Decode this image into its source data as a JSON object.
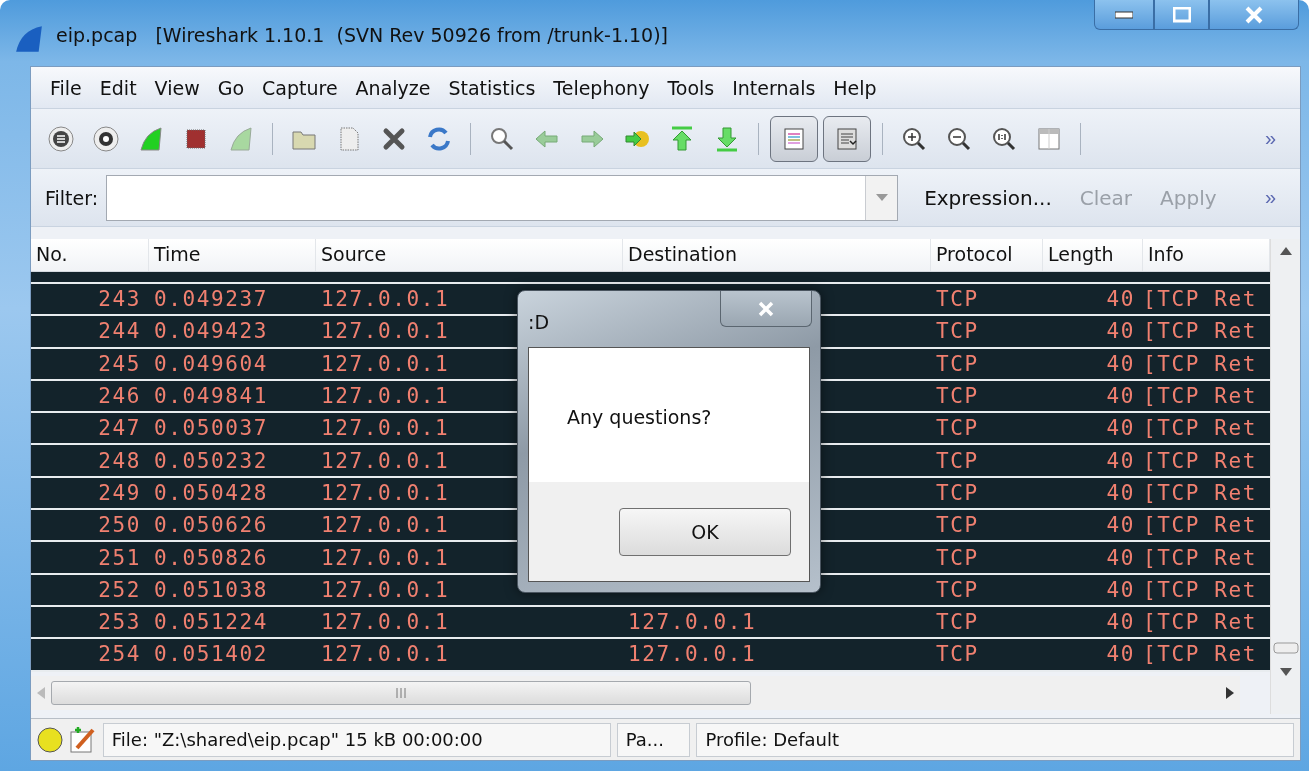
{
  "window": {
    "title": "eip.pcap   [Wireshark 1.10.1  (SVN Rev 50926 from /trunk-1.10)]"
  },
  "menu": [
    "File",
    "Edit",
    "View",
    "Go",
    "Capture",
    "Analyze",
    "Statistics",
    "Telephony",
    "Tools",
    "Internals",
    "Help"
  ],
  "toolbar_toggles": [
    {
      "pressed": true
    },
    {
      "pressed": true
    }
  ],
  "filter": {
    "label": "Filter:",
    "buttons": [
      {
        "label": "Expression...",
        "disabled": false
      },
      {
        "label": "Clear",
        "disabled": true
      },
      {
        "label": "Apply",
        "disabled": true
      }
    ],
    "more": "»"
  },
  "toolbar_more": "»",
  "table": {
    "columns": [
      "No.",
      "Time",
      "Source",
      "Destination",
      "Protocol",
      "Length",
      "Info"
    ],
    "rows": [
      {
        "no": "243",
        "time": "0.049237",
        "source": "127.0.0.1",
        "protocol": "TCP",
        "length": "40",
        "info": "[TCP Ret"
      },
      {
        "no": "244",
        "time": "0.049423",
        "source": "127.0.0.1",
        "protocol": "TCP",
        "length": "40",
        "info": "[TCP Ret"
      },
      {
        "no": "245",
        "time": "0.049604",
        "source": "127.0.0.1",
        "protocol": "TCP",
        "length": "40",
        "info": "[TCP Ret"
      },
      {
        "no": "246",
        "time": "0.049841",
        "source": "127.0.0.1",
        "protocol": "TCP",
        "length": "40",
        "info": "[TCP Ret"
      },
      {
        "no": "247",
        "time": "0.050037",
        "source": "127.0.0.1",
        "protocol": "TCP",
        "length": "40",
        "info": "[TCP Ret"
      },
      {
        "no": "248",
        "time": "0.050232",
        "source": "127.0.0.1",
        "protocol": "TCP",
        "length": "40",
        "info": "[TCP Ret"
      },
      {
        "no": "249",
        "time": "0.050428",
        "source": "127.0.0.1",
        "protocol": "TCP",
        "length": "40",
        "info": "[TCP Ret"
      },
      {
        "no": "250",
        "time": "0.050626",
        "source": "127.0.0.1",
        "protocol": "TCP",
        "length": "40",
        "info": "[TCP Ret"
      },
      {
        "no": "251",
        "time": "0.050826",
        "source": "127.0.0.1",
        "protocol": "TCP",
        "length": "40",
        "info": "[TCP Ret"
      },
      {
        "no": "252",
        "time": "0.051038",
        "source": "127.0.0.1",
        "protocol": "TCP",
        "length": "40",
        "info": "[TCP Ret"
      },
      {
        "no": "253",
        "time": "0.051224",
        "source": "127.0.0.1",
        "destination": "127.0.0.1",
        "protocol": "TCP",
        "length": "40",
        "info": "[TCP Ret"
      },
      {
        "no": "254",
        "time": "0.051402",
        "source": "127.0.0.1",
        "destination": "127.0.0.1",
        "protocol": "TCP",
        "length": "40",
        "info": "[TCP Ret"
      }
    ]
  },
  "dialog": {
    "title": ":D",
    "message": "Any questions?",
    "button": "OK"
  },
  "status_bar": {
    "file": "File: \"Z:\\shared\\eip.pcap\" 15 kB 00:00:00",
    "packets": "Pa...",
    "profile": "Profile: Default"
  }
}
